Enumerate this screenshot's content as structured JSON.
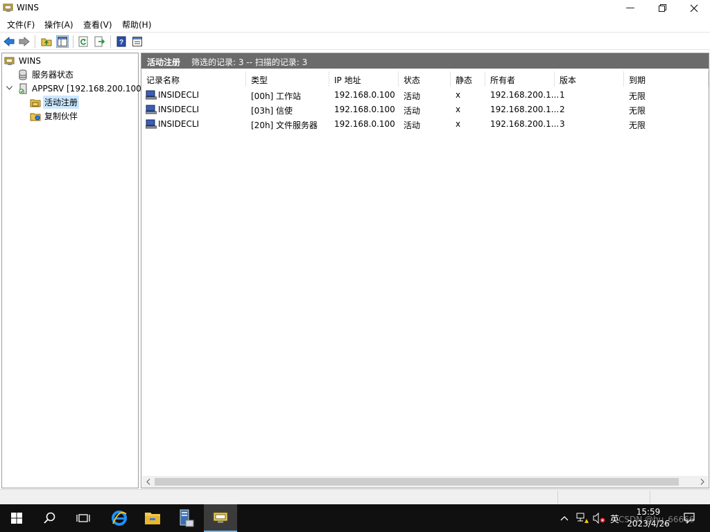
{
  "window": {
    "title": "WINS"
  },
  "menu": [
    "文件(F)",
    "操作(A)",
    "查看(V)",
    "帮助(H)"
  ],
  "tree": {
    "root": "WINS",
    "server_status": "服务器状态",
    "server": "APPSRV [192.168.200.100]",
    "active_registrations": "活动注册",
    "replication_partners": "复制伙伴"
  },
  "pane": {
    "title": "活动注册",
    "info": "筛选的记录: 3 -- 扫描的记录: 3"
  },
  "columns": [
    "记录名称",
    "类型",
    "IP 地址",
    "状态",
    "静态",
    "所有者",
    "版本",
    "到期"
  ],
  "records": [
    {
      "name": "INSIDECLI",
      "type": "[00h] 工作站",
      "ip": "192.168.0.100",
      "state": "活动",
      "static": "x",
      "owner": "192.168.200.1...",
      "version": "1",
      "expiry": "无限"
    },
    {
      "name": "INSIDECLI",
      "type": "[03h] 信使",
      "ip": "192.168.0.100",
      "state": "活动",
      "static": "x",
      "owner": "192.168.200.1...",
      "version": "2",
      "expiry": "无限"
    },
    {
      "name": "INSIDECLI",
      "type": "[20h] 文件服务器",
      "ip": "192.168.0.100",
      "state": "活动",
      "static": "x",
      "owner": "192.168.200.1...",
      "version": "3",
      "expiry": "无限"
    }
  ],
  "taskbar": {
    "ime": "英",
    "time": "15:59",
    "date": "2023/4/26",
    "watermark": "CSDN @hu_66666"
  },
  "icons": {
    "back": "back-arrow-icon",
    "forward": "forward-arrow-icon",
    "up": "up-folder-icon",
    "show_tree": "show-hide-tree-icon",
    "refresh": "refresh-icon",
    "export": "export-list-icon",
    "help": "help-icon",
    "properties": "properties-icon"
  },
  "colors": {
    "header_bg": "#6b6b6b",
    "selection": "#cce8ff",
    "taskbar_bg": "#101010",
    "accent": "#76b9ed"
  }
}
